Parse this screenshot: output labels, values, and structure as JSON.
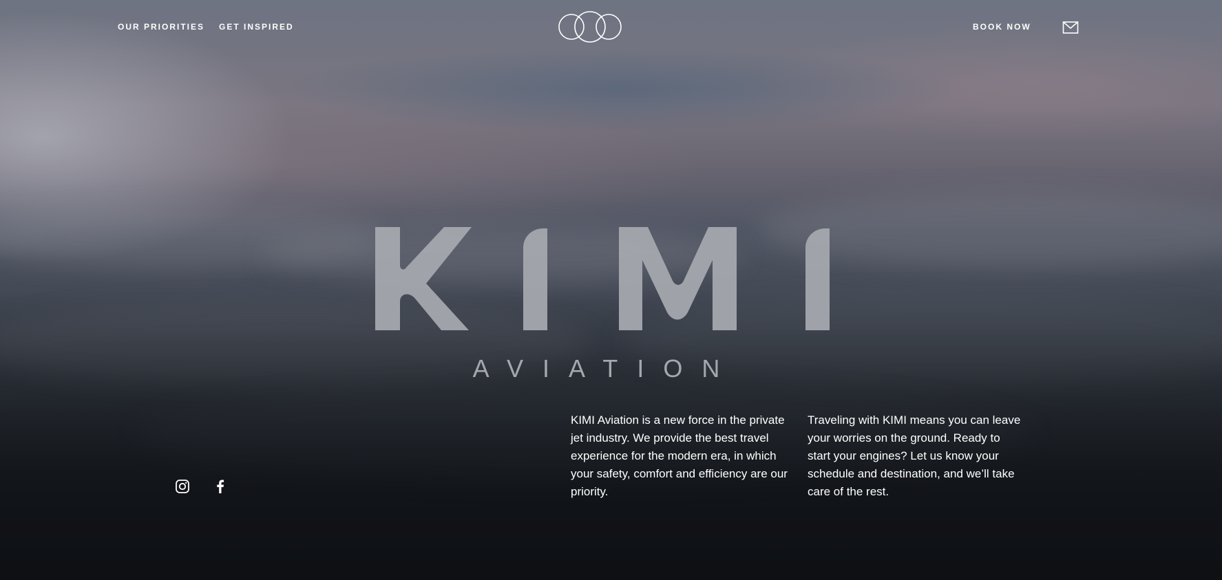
{
  "nav": {
    "left": [
      {
        "label": "OUR PRIORITIES"
      },
      {
        "label": "GET INSPIRED"
      }
    ],
    "book_label": "BOOK NOW",
    "logo_icon": "three-circles-logo-icon",
    "mail_icon": "envelope-icon"
  },
  "brand": {
    "name": "KIMI",
    "subtitle": "AVIATION"
  },
  "content": {
    "paragraph_1": "KIMI Aviation is a new force in the private jet industry. We provide the best travel experience for the modern era, in which your safety, comfort and efficiency are our priority.",
    "paragraph_2": "Traveling with KIMI means you can leave your worries on the ground. Ready to start your engines? Let us know your schedule and destination, and we’ll take care of the rest."
  },
  "social": {
    "icons": [
      "instagram-icon",
      "facebook-icon"
    ]
  },
  "colors": {
    "text": "#ffffff",
    "wordmark": "#a4a8ae"
  }
}
